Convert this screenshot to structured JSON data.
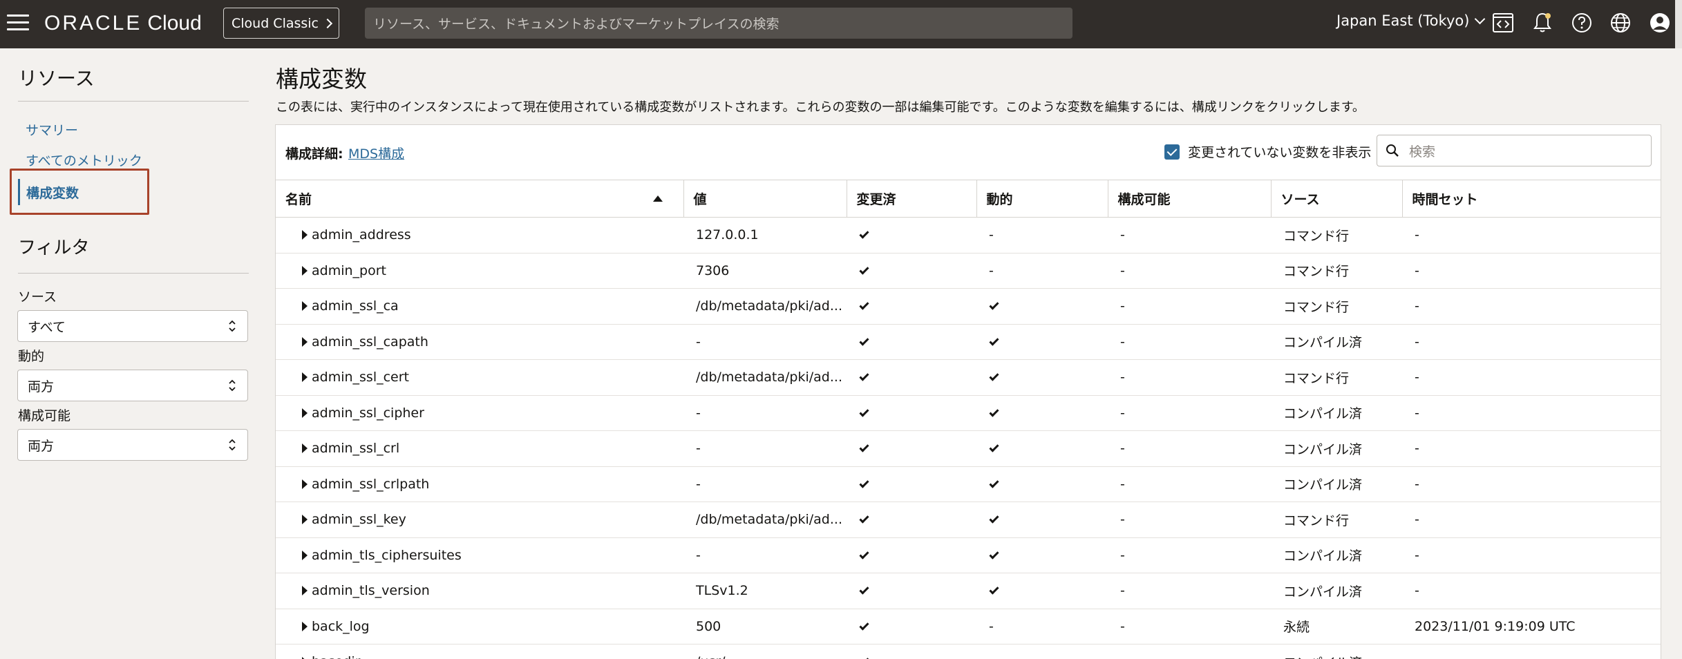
{
  "header": {
    "brand_oracle": "ORACLE",
    "brand_cloud": "Cloud",
    "classic_label": "Cloud Classic",
    "search_placeholder": "リソース、サービス、ドキュメントおよびマーケットプレイスの検索",
    "region": "Japan East (Tokyo)"
  },
  "sidebar": {
    "title": "リソース",
    "links": {
      "summary": "サマリー",
      "all_metrics": "すべてのメトリック",
      "config_vars": "構成変数"
    },
    "filter_title": "フィルタ",
    "filters": {
      "source_label": "ソース",
      "source_value": "すべて",
      "dynamic_label": "動的",
      "dynamic_value": "両方",
      "configurable_label": "構成可能",
      "configurable_value": "両方"
    }
  },
  "main": {
    "title": "構成変数",
    "description": "この表には、実行中のインスタンスによって現在使用されている構成変数がリストされます。これらの変数の一部は編集可能です。このような変数を編集するには、構成リンクをクリックします。",
    "config_detail_label": "構成詳細:",
    "config_link": "MDS構成",
    "hide_unchanged_label": "変更されていない変数を非表示",
    "search_placeholder": "検索"
  },
  "table": {
    "columns": {
      "name": "名前",
      "value": "値",
      "changed": "変更済",
      "dynamic": "動的",
      "configurable": "構成可能",
      "source": "ソース",
      "time_set": "時間セット"
    },
    "rows": [
      {
        "name": "admin_address",
        "value": "127.0.0.1",
        "changed": true,
        "dynamic": "-",
        "configurable": "-",
        "source": "コマンド行",
        "time_set": "-"
      },
      {
        "name": "admin_port",
        "value": "7306",
        "changed": true,
        "dynamic": "-",
        "configurable": "-",
        "source": "コマンド行",
        "time_set": "-"
      },
      {
        "name": "admin_ssl_ca",
        "value": "/db/metadata/pki/ad...",
        "changed": true,
        "dynamic": true,
        "configurable": "-",
        "source": "コマンド行",
        "time_set": "-"
      },
      {
        "name": "admin_ssl_capath",
        "value": "-",
        "changed": true,
        "dynamic": true,
        "configurable": "-",
        "source": "コンパイル済",
        "time_set": "-"
      },
      {
        "name": "admin_ssl_cert",
        "value": "/db/metadata/pki/ad...",
        "changed": true,
        "dynamic": true,
        "configurable": "-",
        "source": "コマンド行",
        "time_set": "-"
      },
      {
        "name": "admin_ssl_cipher",
        "value": "-",
        "changed": true,
        "dynamic": true,
        "configurable": "-",
        "source": "コンパイル済",
        "time_set": "-"
      },
      {
        "name": "admin_ssl_crl",
        "value": "-",
        "changed": true,
        "dynamic": true,
        "configurable": "-",
        "source": "コンパイル済",
        "time_set": "-"
      },
      {
        "name": "admin_ssl_crlpath",
        "value": "-",
        "changed": true,
        "dynamic": true,
        "configurable": "-",
        "source": "コンパイル済",
        "time_set": "-"
      },
      {
        "name": "admin_ssl_key",
        "value": "/db/metadata/pki/ad...",
        "changed": true,
        "dynamic": true,
        "configurable": "-",
        "source": "コマンド行",
        "time_set": "-"
      },
      {
        "name": "admin_tls_ciphersuites",
        "value": "-",
        "changed": true,
        "dynamic": true,
        "configurable": "-",
        "source": "コンパイル済",
        "time_set": "-"
      },
      {
        "name": "admin_tls_version",
        "value": "TLSv1.2",
        "changed": true,
        "dynamic": true,
        "configurable": "-",
        "source": "コンパイル済",
        "time_set": "-"
      },
      {
        "name": "back_log",
        "value": "500",
        "changed": true,
        "dynamic": "-",
        "configurable": "-",
        "source": "永続",
        "time_set": "2023/11/01 9:19:09 UTC"
      },
      {
        "name": "basedir",
        "value": "/usr/",
        "changed": true,
        "dynamic": "",
        "configurable": "",
        "source": "コンパイル済",
        "time_set": ""
      }
    ]
  },
  "colors": {
    "topbar": "#312d2a",
    "link": "#2c6a99",
    "highlight_border": "#a8432a",
    "page_bg": "#f3f1ee"
  }
}
